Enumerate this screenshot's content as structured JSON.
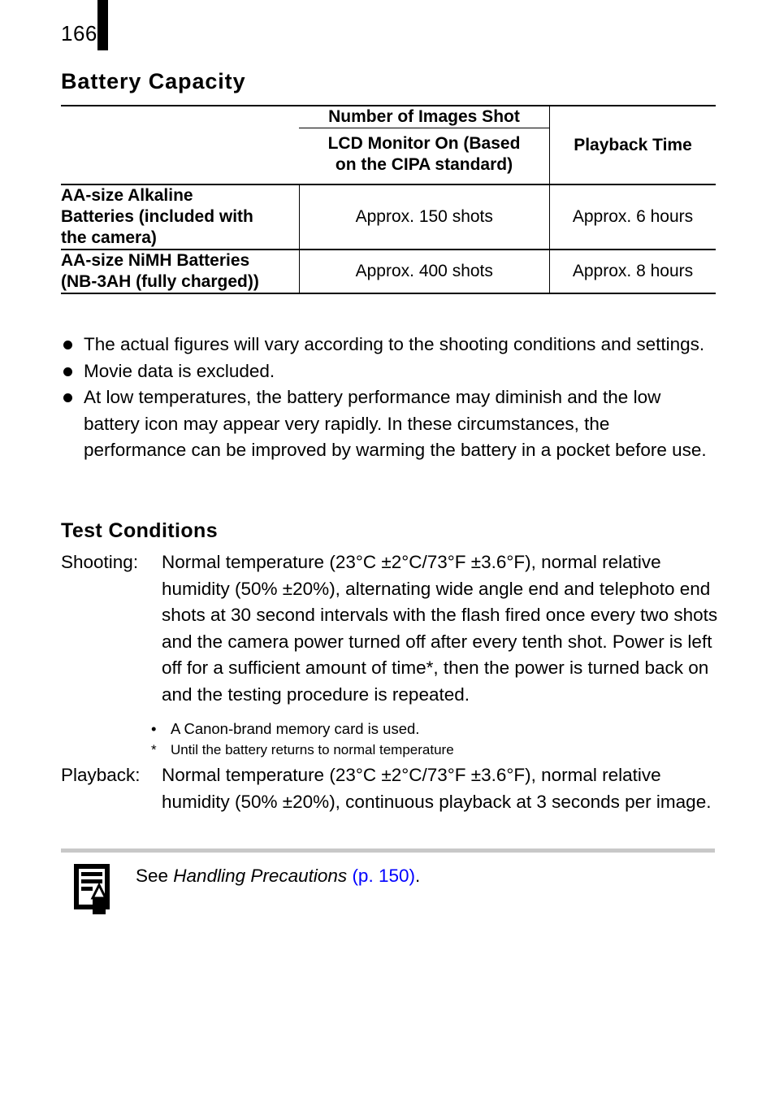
{
  "page": {
    "number": "166"
  },
  "sections": {
    "battery_capacity": {
      "heading": "Battery Capacity"
    },
    "test_conditions": {
      "heading": "Test Conditions"
    }
  },
  "table": {
    "headers": {
      "corner": "",
      "images_shot": "Number of Images Shot",
      "lcd_condition_line1": "LCD Monitor On (Based",
      "lcd_condition_line2": "on the CIPA standard)",
      "playback_time": "Playback Time"
    },
    "rows": [
      {
        "label_line1": "AA-size Alkaline",
        "label_line2": "Batteries (included with",
        "label_line3": "the camera)",
        "shots": "Approx. 150 shots",
        "playback": "Approx. 6 hours"
      },
      {
        "label_line1": "AA-size NiMH Batteries",
        "label_line2": "(NB-3AH (fully charged))",
        "label_line3": "",
        "shots": "Approx. 400 shots",
        "playback": "Approx. 8 hours"
      }
    ]
  },
  "notes": [
    "The actual figures will vary according to the shooting conditions and settings.",
    "Movie data is excluded.",
    "At low temperatures, the battery performance may diminish and the low battery icon may appear very rapidly. In these circumstances, the performance can be improved by warming the battery in a pocket before use."
  ],
  "definitions": {
    "shooting": {
      "term": "Shooting:",
      "body": "Normal temperature (23°C ±2°C/73°F ±3.6°F), normal relative humidity (50% ±20%), alternating wide angle end and telephoto end shots at 30 second intervals with the flash fired once every two shots and the camera power turned off after every tenth shot. Power is left off for a sufficient amount of time*, then the power is turned back on and the testing procedure is repeated."
    },
    "playback": {
      "term": "Playback:",
      "body": "Normal temperature (23°C ±2°C/73°F ±3.6°F), normal relative humidity (50% ±20%), continuous playback at 3 seconds per image."
    }
  },
  "subnotes": [
    {
      "marker": "•",
      "text": "A Canon-brand memory card is used."
    },
    {
      "marker": "*",
      "text": "Until the battery returns to normal temperature"
    }
  ],
  "footer_note": {
    "lead": "See ",
    "reference": "Handling Precautions",
    "page_link": " (p. 150)",
    "trailing": ".",
    "link_color": "#0000ff",
    "divider_color": "#c8c8c8"
  }
}
